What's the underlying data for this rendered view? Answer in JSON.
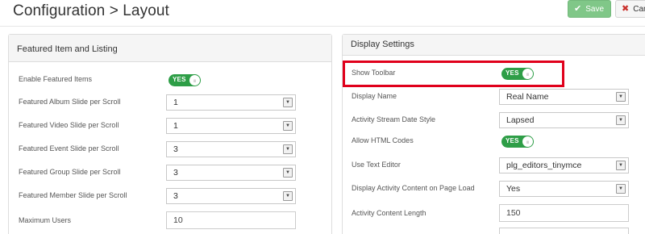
{
  "page": {
    "title": "Configuration > Layout"
  },
  "toolbar": {
    "save_label": "Save",
    "cancel_label": "Cancel",
    "save_color": "#80c788"
  },
  "left_panel": {
    "title": "Featured Item and Listing",
    "enable_featured_label": "Enable Featured Items",
    "enable_featured_toggle": "YES",
    "fields": [
      {
        "label": "Featured Album Slide per Scroll",
        "value": "1"
      },
      {
        "label": "Featured Video Slide per Scroll",
        "value": "1"
      },
      {
        "label": "Featured Event Slide per Scroll",
        "value": "3"
      },
      {
        "label": "Featured Group Slide per Scroll",
        "value": "3"
      },
      {
        "label": "Featured Member Slide per Scroll",
        "value": "3"
      }
    ],
    "max_users_label": "Maximum Users",
    "max_users_value": "10"
  },
  "right_panel": {
    "title": "Display Settings",
    "show_toolbar_label": "Show Toolbar",
    "show_toolbar_toggle": "YES",
    "display_name_label": "Display Name",
    "display_name_value": "Real Name",
    "date_style_label": "Activity Stream Date Style",
    "date_style_value": "Lapsed",
    "allow_html_label": "Allow HTML Codes",
    "allow_html_toggle": "YES",
    "text_editor_label": "Use Text Editor",
    "text_editor_value": "plg_editors_tinymce",
    "activity_on_load_label": "Display Activity Content on Page Load",
    "activity_on_load_value": "Yes",
    "content_length_label": "Activity Content Length",
    "content_length_value": "150"
  },
  "colors": {
    "toggle_on": "#2e9e47",
    "highlight": "#e0001b"
  }
}
